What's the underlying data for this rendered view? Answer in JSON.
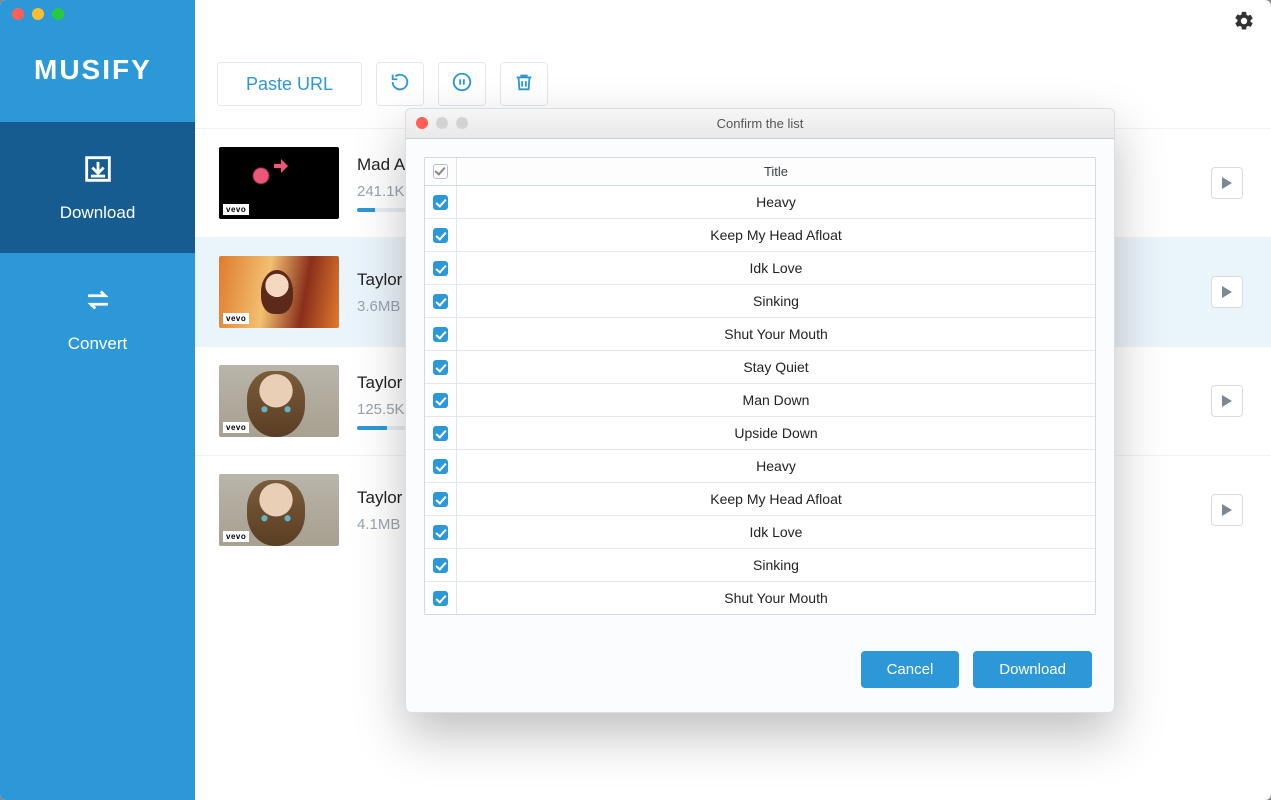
{
  "brand": "MUSIFY",
  "toolbar": {
    "paste": "Paste URL"
  },
  "sidebar": {
    "items": [
      {
        "label": "Download",
        "active": true
      },
      {
        "label": "Convert",
        "active": false
      }
    ]
  },
  "rows": [
    {
      "title": "Mad A",
      "size": "241.1K",
      "progress": 6,
      "selected": false
    },
    {
      "title": "Taylor",
      "size": "3.6MB",
      "progress": 0,
      "selected": true
    },
    {
      "title": "Taylor",
      "size": "125.5K",
      "progress": 10,
      "selected": false
    },
    {
      "title": "Taylor",
      "size": "4.1MB",
      "progress": 0,
      "selected": false
    }
  ],
  "modal": {
    "title": "Confirm the list",
    "header": "Title",
    "cancel": "Cancel",
    "download": "Download",
    "items": [
      {
        "title": "Heavy",
        "checked": true
      },
      {
        "title": "Keep My Head Afloat",
        "checked": true
      },
      {
        "title": "Idk Love",
        "checked": true
      },
      {
        "title": "Sinking",
        "checked": true
      },
      {
        "title": "Shut Your Mouth",
        "checked": true
      },
      {
        "title": "Stay Quiet",
        "checked": true
      },
      {
        "title": "Man Down",
        "checked": true
      },
      {
        "title": "Upside Down",
        "checked": true
      },
      {
        "title": "Heavy",
        "checked": true
      },
      {
        "title": "Keep My Head Afloat",
        "checked": true
      },
      {
        "title": "Idk Love",
        "checked": true
      },
      {
        "title": "Sinking",
        "checked": true
      },
      {
        "title": "Shut Your Mouth",
        "checked": true
      }
    ]
  }
}
